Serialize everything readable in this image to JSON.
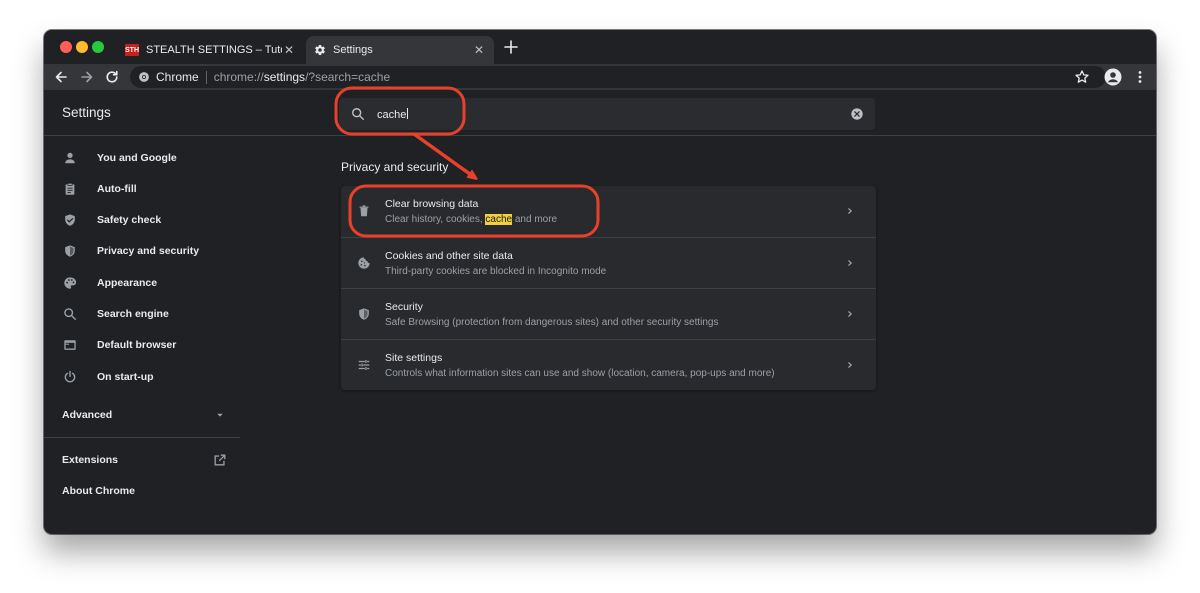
{
  "colors": {
    "window_bg": "#202124",
    "toolbar_bg": "#35363a",
    "card_bg": "#292a2d",
    "text_primary": "#e8eaed",
    "text_secondary": "#9aa0a6",
    "highlight": "#f4d03f",
    "annotation": "#e8412b",
    "traffic_close": "#ff5f57",
    "traffic_min": "#febc2e",
    "traffic_max": "#28c840"
  },
  "tabs": [
    {
      "favicon": "STH",
      "title": "STEALTH SETTINGS – Tutorials",
      "active": false,
      "close_label": "✕"
    },
    {
      "favicon": "gear-icon",
      "title": "Settings",
      "active": true,
      "close_label": "✕"
    }
  ],
  "new_tab_icon": "plus-icon",
  "toolbar": {
    "site_chip": "Chrome",
    "url_scheme": "chrome://",
    "url_host": "settings",
    "url_rest": "/?search=cache"
  },
  "header": {
    "title": "Settings",
    "search": {
      "value": "cache",
      "icon": "search-icon",
      "clear_icon": "clear-icon"
    }
  },
  "sidebar": {
    "items": [
      {
        "label": "You and Google",
        "icon": "person-icon"
      },
      {
        "label": "Auto-fill",
        "icon": "clipboard-icon"
      },
      {
        "label": "Safety check",
        "icon": "shield-check-icon"
      },
      {
        "label": "Privacy and security",
        "icon": "shield-icon"
      },
      {
        "label": "Appearance",
        "icon": "palette-icon"
      },
      {
        "label": "Search engine",
        "icon": "search-icon"
      },
      {
        "label": "Default browser",
        "icon": "browser-icon"
      },
      {
        "label": "On start-up",
        "icon": "power-icon"
      }
    ],
    "advanced": "Advanced",
    "extensions": "Extensions",
    "about": "About Chrome"
  },
  "main": {
    "section_title": "Privacy and security",
    "rows": [
      {
        "title": "Clear browsing data",
        "sub_before": "Clear history, cookies, ",
        "sub_highlight": "cache",
        "sub_after": " and more",
        "icon": "trash-icon"
      },
      {
        "title": "Cookies and other site data",
        "sub": "Third-party cookies are blocked in Incognito mode",
        "icon": "cookie-icon"
      },
      {
        "title": "Security",
        "sub": "Safe Browsing (protection from dangerous sites) and other security settings",
        "icon": "shield-icon"
      },
      {
        "title": "Site settings",
        "sub": "Controls what information sites can use and show (location, camera, pop-ups and more)",
        "icon": "tune-icon"
      }
    ]
  }
}
